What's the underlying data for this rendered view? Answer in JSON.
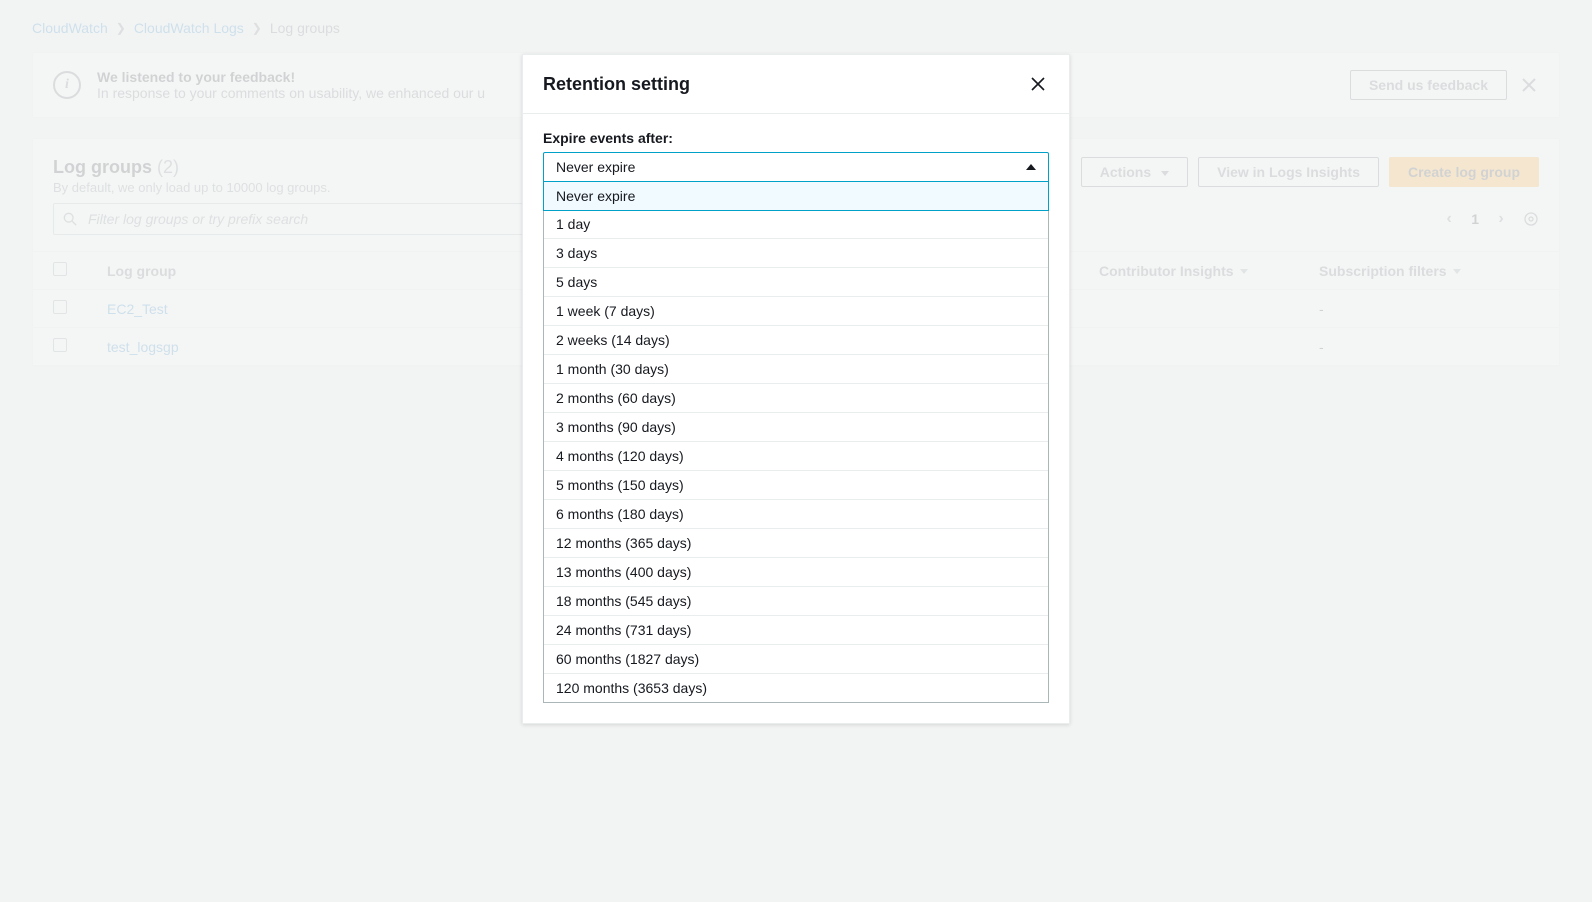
{
  "breadcrumb": {
    "items": [
      {
        "label": "CloudWatch"
      },
      {
        "label": "CloudWatch Logs"
      },
      {
        "label": "Log groups"
      }
    ]
  },
  "banner": {
    "title": "We listened to your feedback!",
    "subtitle": "In response to your comments on usability, we enhanced our u",
    "button": "Send us feedback"
  },
  "panel": {
    "title": "Log groups",
    "count": "(2)",
    "subtitle": "By default, we only load up to 10000 log groups.",
    "actions_label": "Actions",
    "view_insights_label": "View in Logs Insights",
    "create_label": "Create log group"
  },
  "search": {
    "placeholder": "Filter log groups or try prefix search"
  },
  "pager": {
    "page": "1"
  },
  "table": {
    "columns": {
      "log_group": "Log group",
      "contributor_insights": "Contributor Insights",
      "subscription_filters": "Subscription filters"
    },
    "rows": [
      {
        "name": "EC2_Test",
        "subscription_filters": "-"
      },
      {
        "name": "test_logsgp",
        "subscription_filters": "-"
      }
    ]
  },
  "modal": {
    "title": "Retention setting",
    "label": "Expire events after:",
    "selected": "Never expire",
    "options": [
      "Never expire",
      "1 day",
      "3 days",
      "5 days",
      "1 week (7 days)",
      "2 weeks (14 days)",
      "1 month (30 days)",
      "2 months (60 days)",
      "3 months (90 days)",
      "4 months (120 days)",
      "5 months (150 days)",
      "6 months (180 days)",
      "12 months (365 days)",
      "13 months (400 days)",
      "18 months (545 days)",
      "24 months (731 days)",
      "60 months (1827 days)",
      "120 months (3653 days)"
    ]
  }
}
